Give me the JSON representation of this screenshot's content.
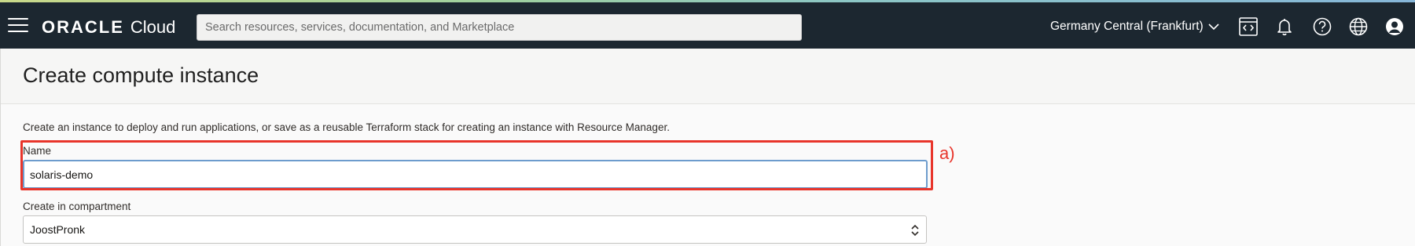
{
  "header": {
    "logo_brand": "ORACLE",
    "logo_product": "Cloud",
    "search_placeholder": "Search resources, services, documentation, and Marketplace",
    "region": "Germany Central (Frankfurt)",
    "icons": [
      "menu-icon",
      "cloud-shell-icon",
      "bell-icon",
      "help-icon",
      "globe-icon",
      "user-profile-icon"
    ]
  },
  "page": {
    "title": "Create compute instance",
    "description": "Create an instance to deploy and run applications, or save as a reusable Terraform stack for creating an instance with Resource Manager."
  },
  "form": {
    "name_label": "Name",
    "name_value": "solaris-demo",
    "compartment_label": "Create in compartment",
    "compartment_value": "JoostPronk"
  },
  "annotation": {
    "label": "a)",
    "color": "#e8352b"
  },
  "colors": {
    "header_bg": "#1c2730",
    "focus_border": "#6d9ccd"
  }
}
